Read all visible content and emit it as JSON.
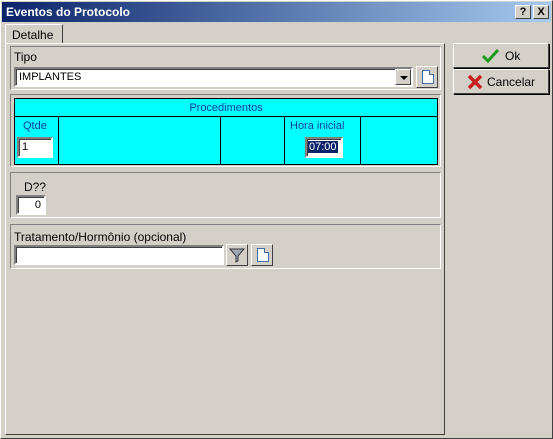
{
  "window": {
    "title": "Eventos do Protocolo",
    "help_label": "?",
    "close_label": "X"
  },
  "tabs": [
    {
      "label": "Detalhe",
      "selected": true
    }
  ],
  "tipo": {
    "label": "Tipo",
    "value": "IMPLANTES"
  },
  "procedimentos": {
    "header": "Procedimentos",
    "qtde_label": "Qtde",
    "qtde_value": "1",
    "hora_label": "Hora inicial",
    "hora_value": "07:00"
  },
  "dias": {
    "label": "D??",
    "value": "0"
  },
  "tratamento": {
    "label": "Tratamento/Hormônio (opcional)",
    "value": ""
  },
  "buttons": {
    "ok_label": "Ok",
    "cancel_label": "Cancelar"
  },
  "colors": {
    "titlebar_start": "#0a246a",
    "titlebar_end": "#a6caf0",
    "panel": "#d4d0c8",
    "procedimentos_bg": "#00ffff",
    "procedimentos_text": "#1a3ea0",
    "ok_icon": "#1a9a1a",
    "cancel_icon": "#c81e1e"
  },
  "icons": {
    "tipo_button": "document-icon",
    "filter_button": "filter-icon",
    "tratamento_button": "document-icon",
    "ok": "checkmark-icon",
    "cancel": "x-icon"
  }
}
